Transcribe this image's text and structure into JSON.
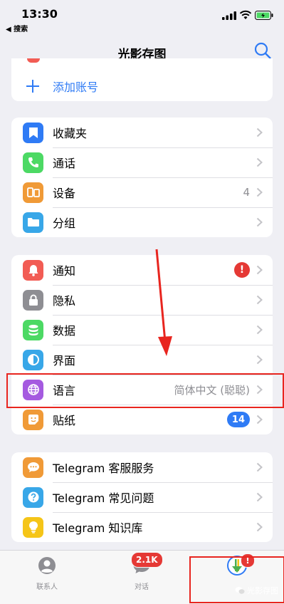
{
  "status": {
    "time": "13:30",
    "back_app": "◀ 搜索"
  },
  "nav": {
    "title": "光影存图"
  },
  "account": {
    "add_label": "添加账号"
  },
  "group1": [
    {
      "label": "收藏夹",
      "color": "#2f7bf5",
      "icon": "bookmark-icon"
    },
    {
      "label": "通话",
      "color": "#4cd964",
      "icon": "phone-icon"
    },
    {
      "label": "设备",
      "color": "#f09a37",
      "icon": "devices-icon",
      "value": "4"
    },
    {
      "label": "分组",
      "color": "#38a7e8",
      "icon": "folder-icon"
    }
  ],
  "group2": [
    {
      "label": "通知",
      "color": "#f25c54",
      "icon": "bell-icon",
      "badge": "!"
    },
    {
      "label": "隐私",
      "color": "#8e8e93",
      "icon": "lock-icon"
    },
    {
      "label": "数据",
      "color": "#4cd964",
      "icon": "database-icon"
    },
    {
      "label": "界面",
      "color": "#38a7e8",
      "icon": "halfmoon-icon"
    },
    {
      "label": "语言",
      "color": "#a55ae0",
      "icon": "globe-icon",
      "value": "简体中文 (聪聪)"
    },
    {
      "label": "贴纸",
      "color": "#f09a37",
      "icon": "sticker-icon",
      "count": "14"
    }
  ],
  "group3": [
    {
      "label": "Telegram 客服服务",
      "color": "#f09a37",
      "icon": "chat-bubble-icon"
    },
    {
      "label": "Telegram 常见问题",
      "color": "#38a7e8",
      "icon": "question-icon"
    },
    {
      "label": "Telegram 知识库",
      "color": "#f5c518",
      "icon": "lightbulb-icon"
    }
  ],
  "tabs": {
    "contacts": "联系人",
    "chats": "对话",
    "chats_badge": "2.1K",
    "settings_badge": "!"
  },
  "watermark": "光影存图"
}
